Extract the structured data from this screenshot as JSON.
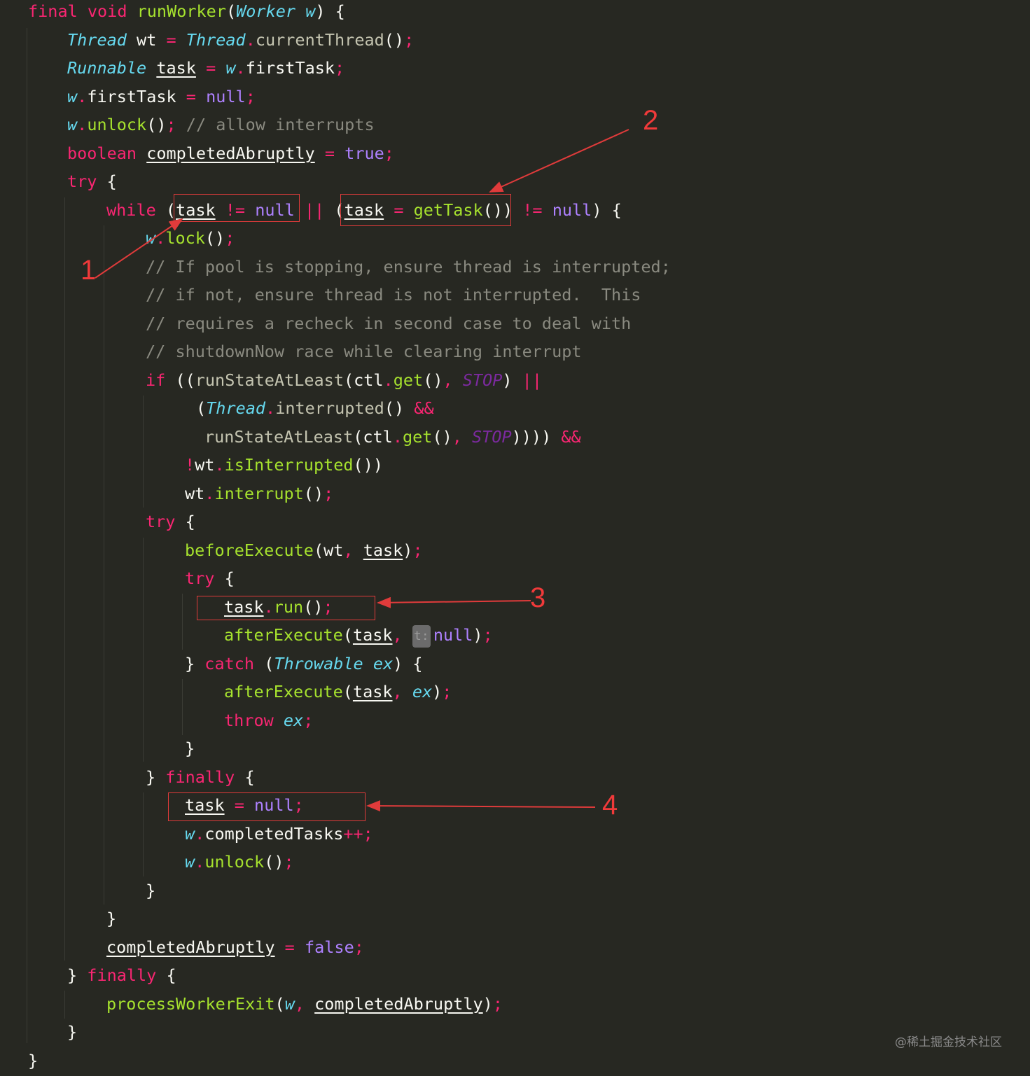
{
  "code_lines": [
    [
      [
        "kw",
        "final "
      ],
      [
        "kw",
        "void "
      ],
      [
        "fn",
        "runWorker"
      ],
      [
        "pl",
        "("
      ],
      [
        "ty",
        "Worker "
      ],
      [
        "it",
        "w"
      ],
      [
        "pl",
        ") {"
      ]
    ],
    [
      [
        "ty",
        "Thread "
      ],
      [
        "pl",
        "wt "
      ],
      [
        "op",
        "= "
      ],
      [
        "ty",
        "Thread"
      ],
      [
        "op",
        "."
      ],
      [
        "fnd",
        "currentThread"
      ],
      [
        "pl",
        "()"
      ],
      [
        "op",
        ";"
      ]
    ],
    [
      [
        "ty",
        "Runnable "
      ],
      [
        "ul",
        "task"
      ],
      [
        "op",
        " = "
      ],
      [
        "it",
        "w"
      ],
      [
        "op",
        "."
      ],
      [
        "pl",
        "firstTask"
      ],
      [
        "op",
        ";"
      ]
    ],
    [
      [
        "it",
        "w"
      ],
      [
        "op",
        "."
      ],
      [
        "pl",
        "firstTask "
      ],
      [
        "op",
        "= "
      ],
      [
        "lit",
        "null"
      ],
      [
        "op",
        ";"
      ]
    ],
    [
      [
        "it",
        "w"
      ],
      [
        "op",
        "."
      ],
      [
        "fn",
        "unlock"
      ],
      [
        "pl",
        "()"
      ],
      [
        "op",
        "; "
      ],
      [
        "cm",
        "// allow interrupts"
      ]
    ],
    [
      [
        "kw",
        "boolean "
      ],
      [
        "ul",
        "completedAbruptly"
      ],
      [
        "op",
        " = "
      ],
      [
        "lit",
        "true"
      ],
      [
        "op",
        ";"
      ]
    ],
    [
      [
        "kw",
        "try "
      ],
      [
        "pl",
        "{"
      ]
    ],
    [
      [
        "kw",
        "while "
      ],
      [
        "pl",
        "("
      ],
      [
        "ul",
        "task"
      ],
      [
        "op",
        " != "
      ],
      [
        "lit",
        "null"
      ],
      [
        "op",
        " || "
      ],
      [
        "pl",
        "("
      ],
      [
        "ul",
        "task"
      ],
      [
        "op",
        " = "
      ],
      [
        "fn",
        "getTask"
      ],
      [
        "pl",
        "()) "
      ],
      [
        "op",
        "!= "
      ],
      [
        "lit",
        "null"
      ],
      [
        "pl",
        ") {"
      ]
    ],
    [
      [
        "it",
        "w"
      ],
      [
        "op",
        "."
      ],
      [
        "fn",
        "lock"
      ],
      [
        "pl",
        "()"
      ],
      [
        "op",
        ";"
      ]
    ],
    [
      [
        "cm",
        "// If pool is stopping, ensure thread is interrupted;"
      ]
    ],
    [
      [
        "cm",
        "// if not, ensure thread is not interrupted.  This"
      ]
    ],
    [
      [
        "cm",
        "// requires a recheck in second case to deal with"
      ]
    ],
    [
      [
        "cm",
        "// shutdownNow race while clearing interrupt"
      ]
    ],
    [
      [
        "kw",
        "if "
      ],
      [
        "pl",
        "(("
      ],
      [
        "fnd",
        "runStateAtLeast"
      ],
      [
        "pl",
        "(ctl"
      ],
      [
        "op",
        "."
      ],
      [
        "fn",
        "get"
      ],
      [
        "pl",
        "()"
      ],
      [
        "op",
        ", "
      ],
      [
        "cst",
        "STOP"
      ],
      [
        "pl",
        ") "
      ],
      [
        "op",
        "||"
      ]
    ],
    [
      [
        "pl",
        "("
      ],
      [
        "ty",
        "Thread"
      ],
      [
        "op",
        "."
      ],
      [
        "fnd",
        "interrupted"
      ],
      [
        "pl",
        "() "
      ],
      [
        "op",
        "&&"
      ]
    ],
    [
      [
        "fnd",
        "runStateAtLeast"
      ],
      [
        "pl",
        "(ctl"
      ],
      [
        "op",
        "."
      ],
      [
        "fn",
        "get"
      ],
      [
        "pl",
        "()"
      ],
      [
        "op",
        ", "
      ],
      [
        "cst",
        "STOP"
      ],
      [
        "pl",
        ")))) "
      ],
      [
        "op",
        "&&"
      ]
    ],
    [
      [
        "op",
        "!"
      ],
      [
        "pl",
        "wt"
      ],
      [
        "op",
        "."
      ],
      [
        "fn",
        "isInterrupted"
      ],
      [
        "pl",
        "())"
      ]
    ],
    [
      [
        "pl",
        "wt"
      ],
      [
        "op",
        "."
      ],
      [
        "fn",
        "interrupt"
      ],
      [
        "pl",
        "()"
      ],
      [
        "op",
        ";"
      ]
    ],
    [
      [
        "kw",
        "try "
      ],
      [
        "pl",
        "{"
      ]
    ],
    [
      [
        "fn",
        "beforeExecute"
      ],
      [
        "pl",
        "(wt"
      ],
      [
        "op",
        ", "
      ],
      [
        "ul",
        "task"
      ],
      [
        "pl",
        ")"
      ],
      [
        "op",
        ";"
      ]
    ],
    [
      [
        "kw",
        "try "
      ],
      [
        "pl",
        "{"
      ]
    ],
    [
      [
        "ul",
        "task"
      ],
      [
        "op",
        "."
      ],
      [
        "fn",
        "run"
      ],
      [
        "pl",
        "()"
      ],
      [
        "op",
        ";"
      ]
    ],
    [
      [
        "fn",
        "afterExecute"
      ],
      [
        "pl",
        "("
      ],
      [
        "ul",
        "task"
      ],
      [
        "op",
        ", "
      ],
      [
        "hint",
        "t:"
      ],
      [
        "lit",
        "null"
      ],
      [
        "pl",
        ")"
      ],
      [
        "op",
        ";"
      ]
    ],
    [
      [
        "pl",
        "} "
      ],
      [
        "kw",
        "catch "
      ],
      [
        "pl",
        "("
      ],
      [
        "ty",
        "Throwable "
      ],
      [
        "it",
        "ex"
      ],
      [
        "pl",
        ") {"
      ]
    ],
    [
      [
        "fn",
        "afterExecute"
      ],
      [
        "pl",
        "("
      ],
      [
        "ul",
        "task"
      ],
      [
        "op",
        ", "
      ],
      [
        "it",
        "ex"
      ],
      [
        "pl",
        ")"
      ],
      [
        "op",
        ";"
      ]
    ],
    [
      [
        "kw",
        "throw "
      ],
      [
        "it",
        "ex"
      ],
      [
        "op",
        ";"
      ]
    ],
    [
      [
        "pl",
        "}"
      ]
    ],
    [
      [
        "pl",
        "} "
      ],
      [
        "kw",
        "finally "
      ],
      [
        "pl",
        "{"
      ]
    ],
    [
      [
        "ul",
        "task"
      ],
      [
        "op",
        " = "
      ],
      [
        "lit",
        "null"
      ],
      [
        "op",
        ";"
      ]
    ],
    [
      [
        "it",
        "w"
      ],
      [
        "op",
        "."
      ],
      [
        "pl",
        "completedTasks"
      ],
      [
        "op",
        "++;"
      ]
    ],
    [
      [
        "it",
        "w"
      ],
      [
        "op",
        "."
      ],
      [
        "fn",
        "unlock"
      ],
      [
        "pl",
        "()"
      ],
      [
        "op",
        ";"
      ]
    ],
    [
      [
        "pl",
        "}"
      ]
    ],
    [
      [
        "pl",
        "}"
      ]
    ],
    [
      [
        "ul",
        "completedAbruptly"
      ],
      [
        "op",
        " = "
      ],
      [
        "lit",
        "false"
      ],
      [
        "op",
        ";"
      ]
    ],
    [
      [
        "pl",
        "} "
      ],
      [
        "kw",
        "finally "
      ],
      [
        "pl",
        "{"
      ]
    ],
    [
      [
        "fn",
        "processWorkerExit"
      ],
      [
        "pl",
        "("
      ],
      [
        "it",
        "w"
      ],
      [
        "op",
        ", "
      ],
      [
        "ul",
        "completedAbruptly"
      ],
      [
        "pl",
        ")"
      ],
      [
        "op",
        ";"
      ]
    ],
    [
      [
        "pl",
        "}"
      ]
    ],
    [
      [
        "pl",
        "}"
      ]
    ]
  ],
  "annotations": [
    "1",
    "2",
    "3",
    "4"
  ],
  "watermark": "@稀土掘金技术社区",
  "colors": {
    "background": "#272822",
    "keyword": "#f92672",
    "type": "#66d9ef",
    "function": "#a6e22e",
    "literal": "#ae81ff",
    "comment": "#8a8a80",
    "annotation": "#e03b3b"
  }
}
